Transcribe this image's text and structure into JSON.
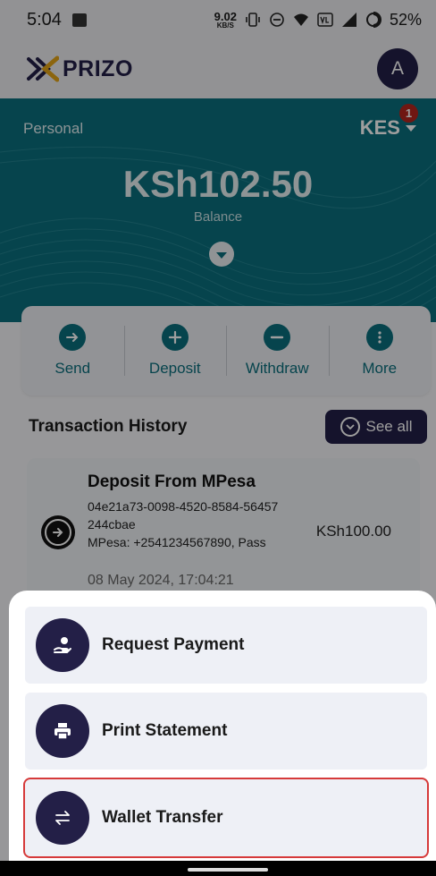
{
  "status_bar": {
    "time": "5:04",
    "speed_value": "9.02",
    "speed_unit": "KB/S",
    "battery": "52%"
  },
  "header": {
    "app_name": "PRIZO",
    "avatar_initial": "A"
  },
  "balance": {
    "account_type": "Personal",
    "currency": "KES",
    "notification_count": "1",
    "amount": "KSh102.50",
    "label": "Balance"
  },
  "actions": [
    {
      "label": "Send",
      "icon": "arrow-right-icon"
    },
    {
      "label": "Deposit",
      "icon": "plus-icon"
    },
    {
      "label": "Withdraw",
      "icon": "minus-icon"
    },
    {
      "label": "More",
      "icon": "more-vertical-icon"
    }
  ],
  "transactions": {
    "title": "Transaction History",
    "see_all_label": "See all",
    "items": [
      {
        "name": "Deposit From MPesa",
        "reference": "04e21a73-0098-4520-8584-56457244cbae",
        "detail": "MPesa: +2541234567890, Pass",
        "date": "08 May 2024, 17:04:21",
        "amount": "KSh100.00"
      }
    ]
  },
  "sheet": {
    "options": [
      {
        "label": "Request Payment",
        "icon": "hand-coin-icon"
      },
      {
        "label": "Print Statement",
        "icon": "printer-icon"
      },
      {
        "label": "Wallet Transfer",
        "icon": "swap-arrows-icon"
      }
    ]
  },
  "colors": {
    "primary_dark": "#231f47",
    "teal": "#0b6e7c",
    "highlight": "#d63a3a"
  }
}
